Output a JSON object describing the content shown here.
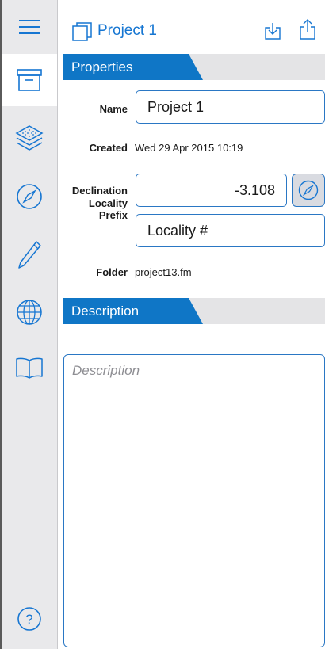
{
  "header": {
    "title": "Project 1",
    "title_icon": "copy-icon",
    "actions": [
      "download-icon",
      "share-icon"
    ]
  },
  "sidebar": {
    "items": [
      {
        "icon": "menu-icon",
        "active": false
      },
      {
        "icon": "archive-box-icon",
        "active": true
      },
      {
        "icon": "layers-icon",
        "active": false
      },
      {
        "icon": "compass-icon",
        "active": false
      },
      {
        "icon": "pencil-icon",
        "active": false
      },
      {
        "icon": "globe-icon",
        "active": false
      },
      {
        "icon": "book-icon",
        "active": false
      },
      {
        "icon": "help-icon",
        "active": false
      }
    ]
  },
  "properties": {
    "section_label": "Properties",
    "name_label": "Name",
    "name_value": "Project 1",
    "created_label": "Created",
    "created_value": "Wed 29 Apr 2015 10:19",
    "declination_label": "Declination",
    "declination_value": "-3.108",
    "locality_label_line1": "Locality",
    "locality_label_line2": "Prefix",
    "locality_value": "Locality #",
    "folder_label": "Folder",
    "folder_value": "project13.fm"
  },
  "description": {
    "section_label": "Description",
    "placeholder": "Description",
    "value": ""
  },
  "colors": {
    "accent": "#0f76c6",
    "sidebar_bg": "#e9e9eb",
    "section_bg": "#e4e4e6",
    "field_border": "#2a77c4"
  }
}
